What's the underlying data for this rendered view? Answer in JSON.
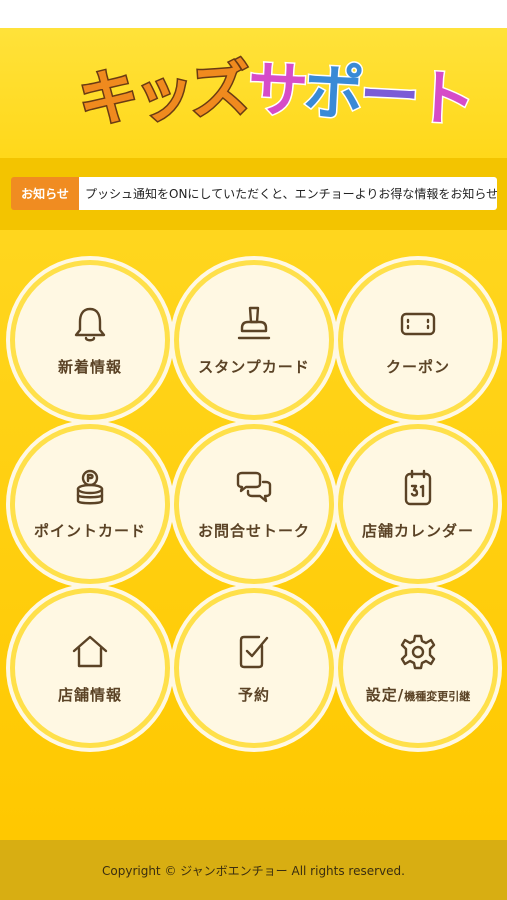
{
  "header": {
    "logo_text": "キッズサポート"
  },
  "ticker": {
    "label": "お知らせ",
    "message": "プッシュ通知をONにしていただくと、エンチョーよりお得な情報をお知らせします"
  },
  "menu": [
    {
      "label": "新着情報",
      "icon": "bell-icon"
    },
    {
      "label": "スタンプカード",
      "icon": "stamp-icon"
    },
    {
      "label": "クーポン",
      "icon": "coupon-icon"
    },
    {
      "label": "ポイントカード",
      "icon": "point-coins-icon"
    },
    {
      "label": "お問合せトーク",
      "icon": "chat-bubbles-icon"
    },
    {
      "label": "店舗カレンダー",
      "icon": "calendar-icon"
    },
    {
      "label": "店舗情報",
      "icon": "home-icon"
    },
    {
      "label": "予約",
      "icon": "reservation-check-icon"
    },
    {
      "label": "設定/",
      "label_small": "機種変更引継",
      "icon": "gear-icon"
    }
  ],
  "footer": {
    "copyright": "Copyright © ジャンボエンチョー All rights reserved."
  },
  "colors": {
    "header_bg": "#ffe23a",
    "main_bg": "#ffd61e",
    "ticker_label_bg": "#f08c21",
    "icon_stroke": "#5b4326",
    "footer_bg": "#d8ae12"
  }
}
